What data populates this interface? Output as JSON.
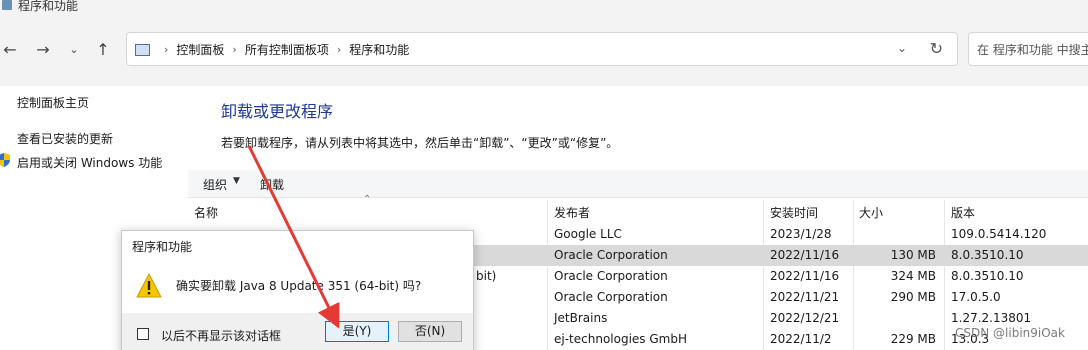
{
  "window": {
    "title": "程序和功能"
  },
  "address": {
    "crumbs": [
      "控制面板",
      "所有控制面板项",
      "程序和功能"
    ],
    "search_placeholder": "在 程序和功能 中搜主"
  },
  "sidebar": {
    "items": [
      {
        "label": "控制面板主页"
      },
      {
        "label": "查看已安装的更新"
      },
      {
        "label": "启用或关闭 Windows 功能"
      }
    ]
  },
  "main": {
    "title": "卸载或更改程序",
    "description": "若要卸载程序，请从列表中将其选中，然后单击“卸载”、“更改”或“修复”。"
  },
  "toolbar": {
    "organize": "组织",
    "uninstall": "卸载"
  },
  "table": {
    "headers": {
      "name": "名称",
      "publisher": "发布者",
      "installed": "安装时间",
      "size": "大小",
      "version": "版本"
    },
    "rows": [
      {
        "name": "",
        "publisher": "Google LLC",
        "installed": "2023/1/28",
        "size": "",
        "version": "109.0.5414.120"
      },
      {
        "name": "",
        "publisher": "Oracle Corporation",
        "installed": "2022/11/16",
        "size": "130 MB",
        "version": "8.0.3510.10"
      },
      {
        "name": "bit)",
        "publisher": "Oracle Corporation",
        "installed": "2022/11/16",
        "size": "324 MB",
        "version": "8.0.3510.10"
      },
      {
        "name": "",
        "publisher": "Oracle Corporation",
        "installed": "2022/11/21",
        "size": "290 MB",
        "version": "17.0.5.0"
      },
      {
        "name": "",
        "publisher": "JetBrains",
        "installed": "2022/12/21",
        "size": "",
        "version": "1.27.2.13801"
      },
      {
        "name": "",
        "publisher": "ej-technologies GmbH",
        "installed": "2022/11/2",
        "size": "229 MB",
        "version": "13.0.3"
      }
    ]
  },
  "dialog": {
    "title": "程序和功能",
    "message": "确实要卸载 Java 8 Update 351 (64-bit) 吗?",
    "checkbox_label": "以后不再显示该对话框",
    "yes_label": "是(Y)",
    "no_label": "否(N)"
  },
  "watermark": "CSDN @libin9iOak",
  "colors": {
    "title_blue": "#1f3a93",
    "selected_row": "#d9d9d9",
    "annotation_red": "#e53935"
  }
}
